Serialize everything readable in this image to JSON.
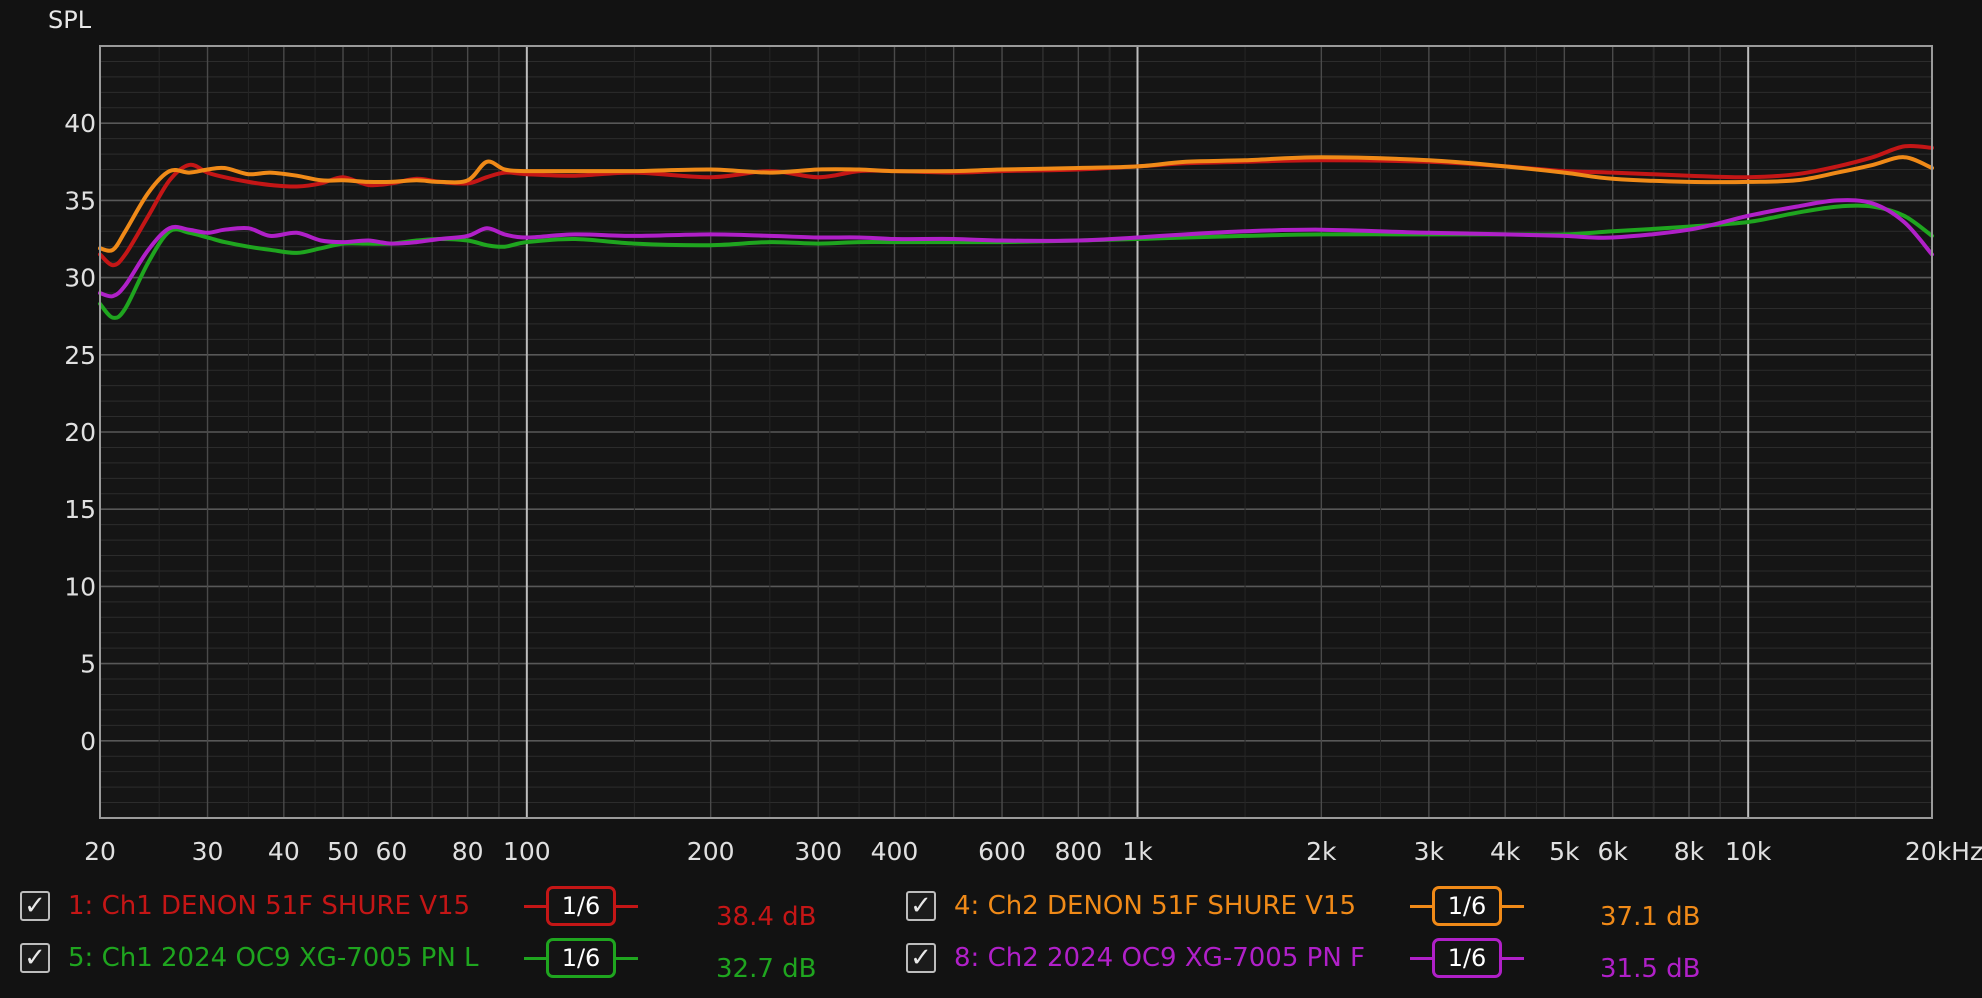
{
  "chart_data": {
    "type": "line",
    "title": "",
    "ylabel": "SPL",
    "xunit": "kHz",
    "x_scale": "log",
    "xlim": [
      20,
      20000
    ],
    "ylim": [
      -5,
      45
    ],
    "yticks": [
      0,
      5,
      10,
      15,
      20,
      25,
      30,
      35,
      40
    ],
    "xticks": [
      {
        "v": 20,
        "l": "20"
      },
      {
        "v": 30,
        "l": "30"
      },
      {
        "v": 40,
        "l": "40"
      },
      {
        "v": 50,
        "l": "50"
      },
      {
        "v": 60,
        "l": "60"
      },
      {
        "v": 80,
        "l": "80"
      },
      {
        "v": 100,
        "l": "100"
      },
      {
        "v": 200,
        "l": "200"
      },
      {
        "v": 300,
        "l": "300"
      },
      {
        "v": 400,
        "l": "400"
      },
      {
        "v": 600,
        "l": "600"
      },
      {
        "v": 800,
        "l": "800"
      },
      {
        "v": 1000,
        "l": "1k"
      },
      {
        "v": 2000,
        "l": "2k"
      },
      {
        "v": 3000,
        "l": "3k"
      },
      {
        "v": 4000,
        "l": "4k"
      },
      {
        "v": 5000,
        "l": "5k"
      },
      {
        "v": 6000,
        "l": "6k"
      },
      {
        "v": 8000,
        "l": "8k"
      },
      {
        "v": 10000,
        "l": "10k"
      },
      {
        "v": 20000,
        "l": "20kHz"
      }
    ],
    "grid": true,
    "legend_position": "bottom",
    "series": [
      {
        "name": "1: Ch1 DENON 51F SHURE V15",
        "color": "#c41616",
        "smoothing": "1/6",
        "value": "38.4 dB",
        "x": [
          20,
          21,
          22,
          24,
          26,
          28,
          30,
          32,
          35,
          38,
          42,
          46,
          50,
          55,
          60,
          66,
          72,
          80,
          86,
          92,
          100,
          120,
          150,
          200,
          250,
          300,
          350,
          400,
          500,
          600,
          800,
          1000,
          1200,
          1500,
          2000,
          3000,
          4000,
          5000,
          6000,
          8000,
          10000,
          12000,
          14000,
          16000,
          18000,
          20000
        ],
        "y": [
          31.5,
          30.8,
          31.5,
          34.0,
          36.3,
          37.3,
          36.8,
          36.5,
          36.2,
          36.0,
          35.9,
          36.1,
          36.5,
          36.0,
          36.1,
          36.4,
          36.2,
          36.1,
          36.5,
          36.8,
          36.7,
          36.6,
          36.8,
          36.5,
          36.9,
          36.5,
          36.9,
          36.9,
          36.8,
          36.9,
          37.0,
          37.2,
          37.4,
          37.5,
          37.6,
          37.5,
          37.2,
          36.9,
          36.8,
          36.6,
          36.5,
          36.7,
          37.2,
          37.8,
          38.5,
          38.4
        ]
      },
      {
        "name": "4: Ch2 DENON 51F SHURE V15",
        "color": "#f08a18",
        "smoothing": "1/6",
        "value": "37.1 dB",
        "x": [
          20,
          21,
          22,
          24,
          26,
          28,
          30,
          32,
          35,
          38,
          42,
          46,
          50,
          55,
          60,
          66,
          72,
          80,
          86,
          92,
          100,
          120,
          150,
          200,
          250,
          300,
          350,
          400,
          500,
          600,
          800,
          1000,
          1200,
          1500,
          2000,
          3000,
          4000,
          5000,
          6000,
          8000,
          10000,
          12000,
          14000,
          16000,
          18000,
          20000
        ],
        "y": [
          31.9,
          31.8,
          33.0,
          35.5,
          36.9,
          36.8,
          37.0,
          37.1,
          36.7,
          36.8,
          36.6,
          36.3,
          36.3,
          36.2,
          36.2,
          36.3,
          36.2,
          36.3,
          37.5,
          37.0,
          36.9,
          36.9,
          36.9,
          37.0,
          36.8,
          37.0,
          37.0,
          36.9,
          36.9,
          37.0,
          37.1,
          37.2,
          37.5,
          37.6,
          37.8,
          37.6,
          37.2,
          36.8,
          36.4,
          36.2,
          36.2,
          36.3,
          36.8,
          37.3,
          37.8,
          37.1
        ]
      },
      {
        "name": "5: Ch1 2024 OC9 XG-7005 PN L",
        "color": "#1fa51f",
        "smoothing": "1/6",
        "value": "32.7 dB",
        "x": [
          20,
          21,
          22,
          24,
          26,
          28,
          30,
          32,
          35,
          38,
          42,
          46,
          50,
          55,
          60,
          66,
          72,
          80,
          86,
          92,
          100,
          120,
          150,
          200,
          250,
          300,
          350,
          400,
          500,
          600,
          800,
          1000,
          1200,
          1500,
          2000,
          3000,
          4000,
          5000,
          6000,
          8000,
          10000,
          12000,
          14000,
          16000,
          18000,
          20000
        ],
        "y": [
          28.3,
          27.4,
          28.0,
          31.0,
          33.0,
          32.9,
          32.6,
          32.3,
          32.0,
          31.8,
          31.6,
          31.9,
          32.2,
          32.2,
          32.2,
          32.4,
          32.5,
          32.4,
          32.1,
          32.0,
          32.3,
          32.5,
          32.2,
          32.1,
          32.3,
          32.2,
          32.3,
          32.3,
          32.3,
          32.3,
          32.4,
          32.5,
          32.6,
          32.7,
          32.8,
          32.8,
          32.8,
          32.8,
          33.0,
          33.3,
          33.6,
          34.2,
          34.6,
          34.6,
          34.0,
          32.7
        ]
      },
      {
        "name": "8: Ch2 2024 OC9 XG-7005 PN F",
        "color": "#b020c8",
        "smoothing": "1/6",
        "value": "31.5 dB",
        "x": [
          20,
          21,
          22,
          24,
          26,
          28,
          30,
          32,
          35,
          38,
          42,
          46,
          50,
          55,
          60,
          66,
          72,
          80,
          86,
          92,
          100,
          120,
          150,
          200,
          250,
          300,
          350,
          400,
          500,
          600,
          800,
          1000,
          1200,
          1500,
          2000,
          3000,
          4000,
          5000,
          6000,
          8000,
          10000,
          12000,
          14000,
          16000,
          18000,
          20000
        ],
        "y": [
          29.0,
          28.8,
          29.5,
          31.8,
          33.2,
          33.1,
          32.9,
          33.1,
          33.2,
          32.7,
          32.9,
          32.4,
          32.3,
          32.4,
          32.2,
          32.3,
          32.5,
          32.7,
          33.2,
          32.8,
          32.6,
          32.8,
          32.7,
          32.8,
          32.7,
          32.6,
          32.6,
          32.5,
          32.5,
          32.4,
          32.4,
          32.6,
          32.8,
          33.0,
          33.1,
          32.9,
          32.8,
          32.7,
          32.6,
          33.1,
          34.0,
          34.6,
          35.0,
          34.8,
          33.6,
          31.5
        ]
      }
    ]
  }
}
